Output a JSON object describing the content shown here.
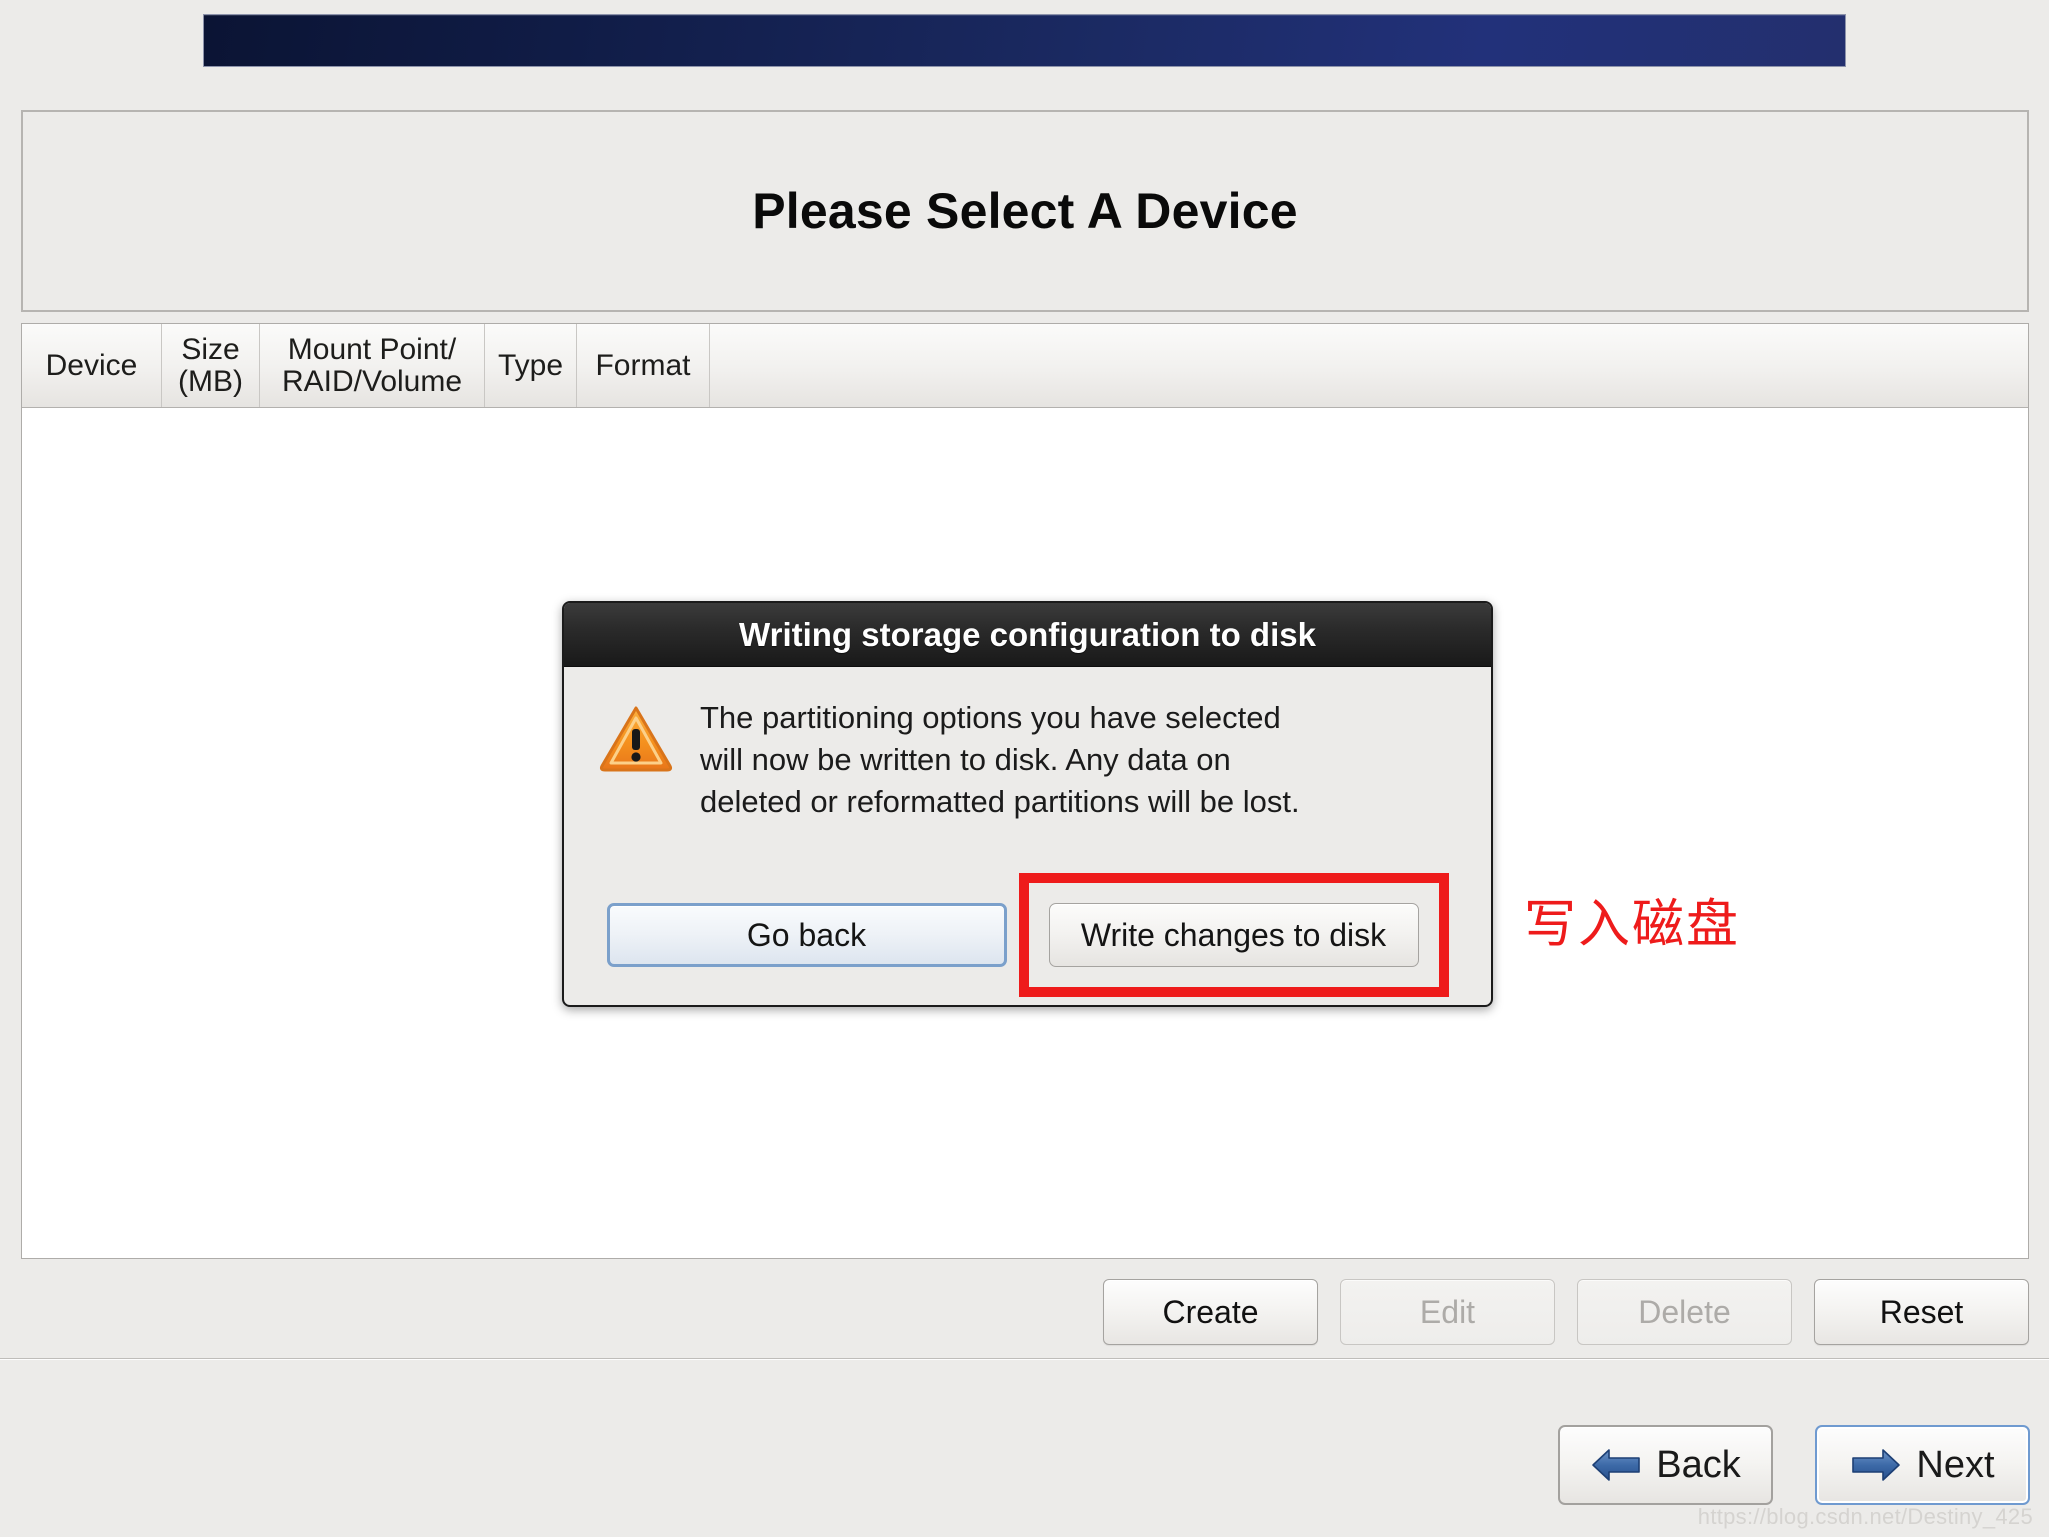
{
  "banner": {
    "name": "top-banner"
  },
  "header": {
    "title": "Please Select A Device"
  },
  "table": {
    "columns": [
      {
        "key": "device",
        "label": "Device"
      },
      {
        "key": "size",
        "label": "Size\n(MB)"
      },
      {
        "key": "mount",
        "label": "Mount Point/\nRAID/Volume"
      },
      {
        "key": "type",
        "label": "Type"
      },
      {
        "key": "format",
        "label": "Format"
      }
    ],
    "rows": []
  },
  "actions": {
    "create_label": "Create",
    "edit_label": "Edit",
    "delete_label": "Delete",
    "reset_label": "Reset"
  },
  "nav": {
    "back_label": "Back",
    "next_label": "Next"
  },
  "dialog": {
    "title": "Writing storage configuration to disk",
    "message": "The partitioning options you have selected\nwill now be written to disk.  Any data on\ndeleted or reformatted partitions will be lost.",
    "go_back_label": "Go back",
    "write_changes_label": "Write changes to disk"
  },
  "annotation": {
    "text": "写入磁盘",
    "color": "#ee1b1b"
  },
  "watermark": {
    "text": "https://blog.csdn.net/Destiny_425"
  },
  "colors": {
    "window_bg": "#ecebe9",
    "banner_dark": "#0b1434",
    "banner_light": "#232f6e",
    "highlight_red": "#ee1b1b",
    "focus_blue": "#7ba0cb",
    "warning_orange": "#f5911e"
  }
}
